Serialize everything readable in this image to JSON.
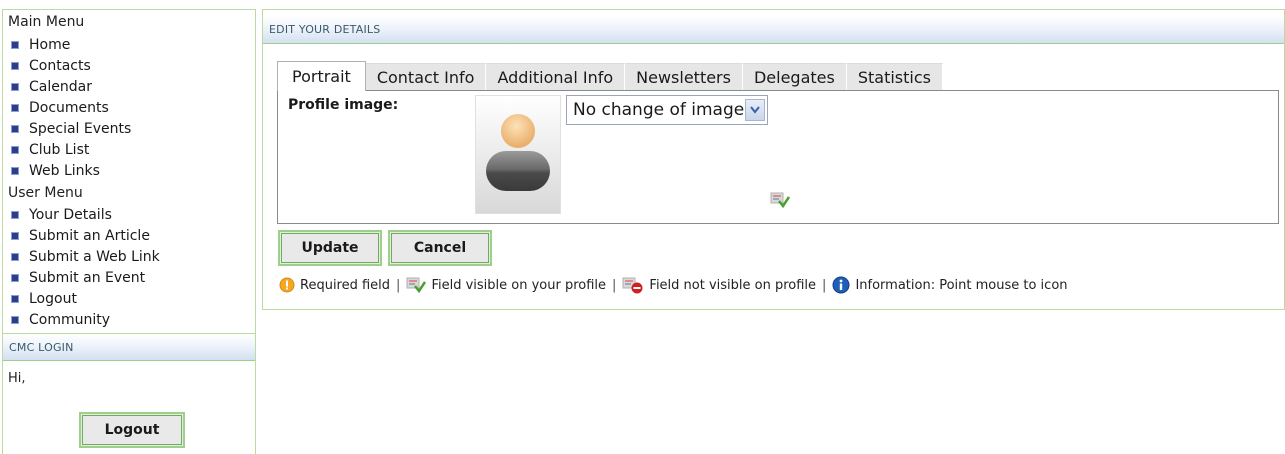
{
  "sidebar": {
    "main_menu_heading": "Main Menu",
    "main_menu": [
      "Home",
      "Contacts",
      "Calendar",
      "Documents",
      "Special Events",
      "Club List",
      "Web Links"
    ],
    "user_menu_heading": "User Menu",
    "user_menu": [
      "Your Details",
      "Submit an Article",
      "Submit a Web Link",
      "Submit an Event",
      "Logout",
      "Community"
    ],
    "login_heading": "CMC LOGIN",
    "greeting": "Hi,",
    "logout_button": "Logout"
  },
  "main": {
    "heading": "EDIT YOUR DETAILS",
    "tabs": [
      "Portrait",
      "Contact Info",
      "Additional Info",
      "Newsletters",
      "Delegates",
      "Statistics"
    ],
    "active_tab": "Portrait",
    "profile_label": "Profile image:",
    "image_select_value": "No change of image",
    "update_button": "Update",
    "cancel_button": "Cancel",
    "legend": {
      "required": "Required field",
      "visible": "Field visible on your profile",
      "not_visible": "Field not visible on profile",
      "info": "Information: Point mouse to icon",
      "separator": "|"
    }
  },
  "colors": {
    "border_green": "#b9dca0",
    "band_blue": "#d3e0f1",
    "bullet_blue": "#2d3d8a",
    "required_orange": "#f5a623",
    "info_blue": "#1f5fb8",
    "not_visible_red": "#d21f1f"
  }
}
